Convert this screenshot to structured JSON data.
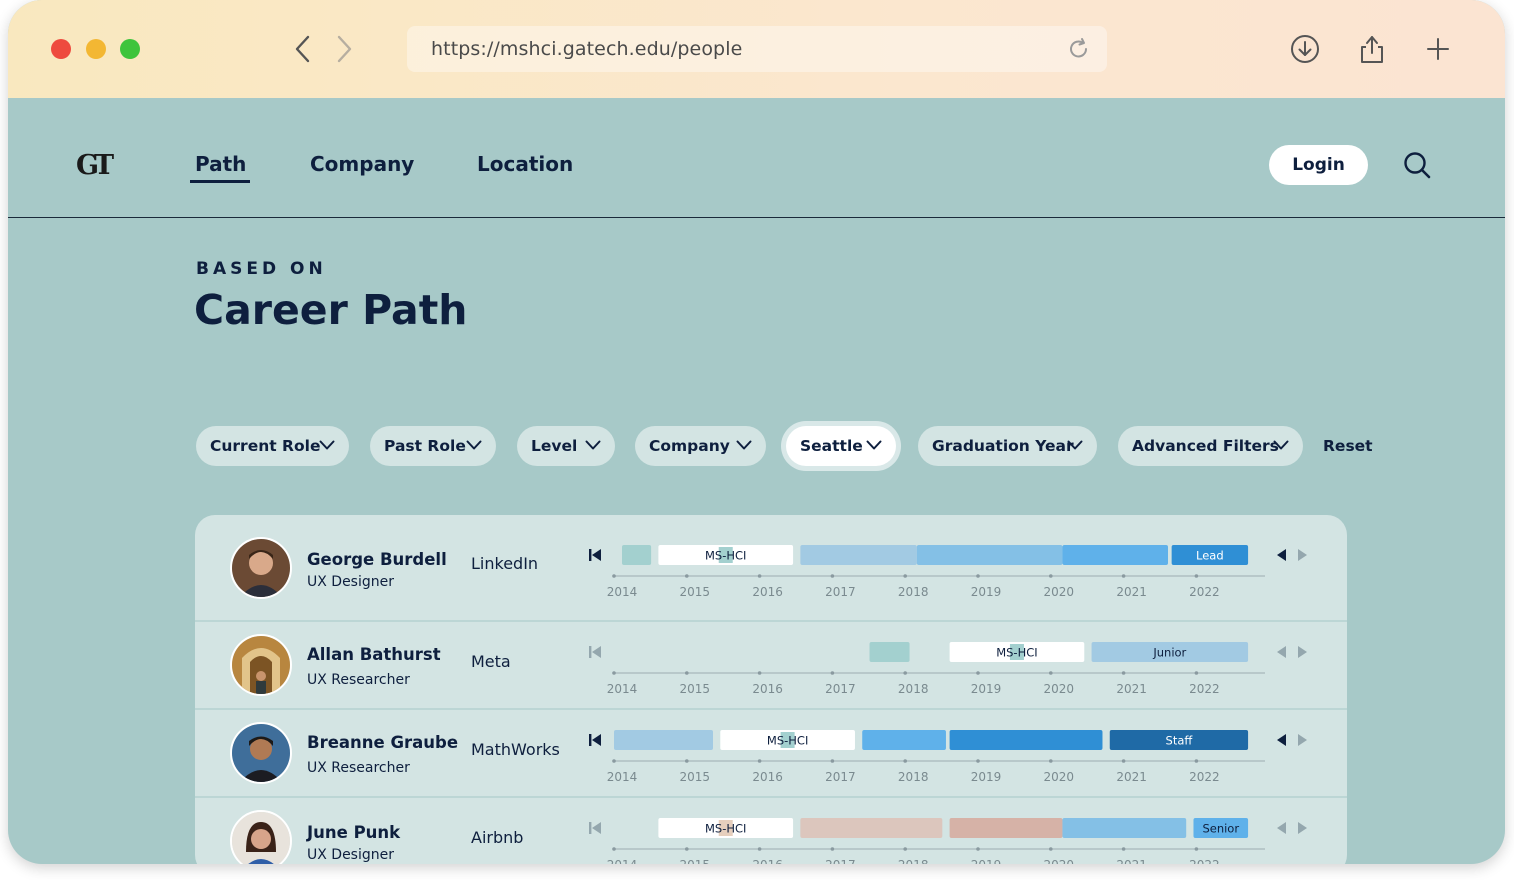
{
  "browser": {
    "url": "https://mshci.gatech.edu/people"
  },
  "nav": {
    "logo": "GT",
    "links": [
      "Path",
      "Company",
      "Location"
    ],
    "active": "Path",
    "login_label": "Login"
  },
  "header": {
    "kicker": "BASED ON",
    "title": "Career Path"
  },
  "filters": {
    "items": [
      "Current Role",
      "Past Role",
      "Level",
      "Company",
      "Seattle",
      "Graduation Year",
      "Advanced Filters"
    ],
    "active": "Seattle",
    "reset_label": "Reset"
  },
  "years": [
    "2014",
    "2015",
    "2016",
    "2017",
    "2018",
    "2019",
    "2020",
    "2021",
    "2022"
  ],
  "people": [
    {
      "name": "George Burdell",
      "role": "UX Designer",
      "company": "LinkedIn",
      "segments": [
        {
          "start": 2014.0,
          "end": 2014.4,
          "color": "#a3d0cf",
          "label": ""
        },
        {
          "start": 2014.5,
          "end": 2016.35,
          "color": "#ffffff",
          "label": "MS-HCI",
          "label_color": "#0e1f3e",
          "marker": "#a3d0cf"
        },
        {
          "start": 2016.45,
          "end": 2018.05,
          "color": "#a2cae3",
          "label": ""
        },
        {
          "start": 2018.05,
          "end": 2020.05,
          "color": "#84c0e6",
          "label": ""
        },
        {
          "start": 2020.05,
          "end": 2021.5,
          "color": "#5fb1ea",
          "label": ""
        },
        {
          "start": 2021.55,
          "end": 2022.6,
          "color": "#2f8fd5",
          "label": "Lead",
          "label_color": "#ffffff"
        }
      ]
    },
    {
      "name": "Allan Bathurst",
      "role": "UX Researcher",
      "company": "Meta",
      "segments": [
        {
          "start": 2017.4,
          "end": 2017.95,
          "color": "#a3d0cf",
          "label": ""
        },
        {
          "start": 2018.5,
          "end": 2020.35,
          "color": "#ffffff",
          "label": "MS-HCI",
          "label_color": "#0e1f3e",
          "marker": "#a3d0cf"
        },
        {
          "start": 2020.45,
          "end": 2022.6,
          "color": "#a2cae3",
          "label": "Junior",
          "label_color": "#0e1f3e"
        }
      ]
    },
    {
      "name": "Breanne Graube",
      "role": "UX Researcher",
      "company": "MathWorks",
      "segments": [
        {
          "start": 2013.6,
          "end": 2015.25,
          "color": "#a2cae3",
          "label": ""
        },
        {
          "start": 2015.35,
          "end": 2017.2,
          "color": "#ffffff",
          "label": "MS-HCI",
          "label_color": "#0e1f3e",
          "marker": "#a3d0cf"
        },
        {
          "start": 2017.3,
          "end": 2018.45,
          "color": "#5fb1ea",
          "label": ""
        },
        {
          "start": 2018.5,
          "end": 2020.6,
          "color": "#2f8fd5",
          "label": ""
        },
        {
          "start": 2020.7,
          "end": 2022.6,
          "color": "#1f6aa6",
          "label": "Staff",
          "label_color": "#ffffff"
        }
      ]
    },
    {
      "name": "June Punk",
      "role": "UX Designer",
      "company": "Airbnb",
      "segments": [
        {
          "start": 2014.5,
          "end": 2016.35,
          "color": "#ffffff",
          "label": "MS-HCI",
          "label_color": "#0e1f3e",
          "marker": "#e6cfbd"
        },
        {
          "start": 2016.45,
          "end": 2018.4,
          "color": "#dcc6bd",
          "label": ""
        },
        {
          "start": 2018.5,
          "end": 2020.05,
          "color": "#d6b2a7",
          "label": ""
        },
        {
          "start": 2020.05,
          "end": 2021.75,
          "color": "#84c0e6",
          "label": ""
        },
        {
          "start": 2021.85,
          "end": 2022.6,
          "color": "#5fb1ea",
          "label": "Senior",
          "label_color": "#0e1f3e"
        }
      ]
    }
  ]
}
